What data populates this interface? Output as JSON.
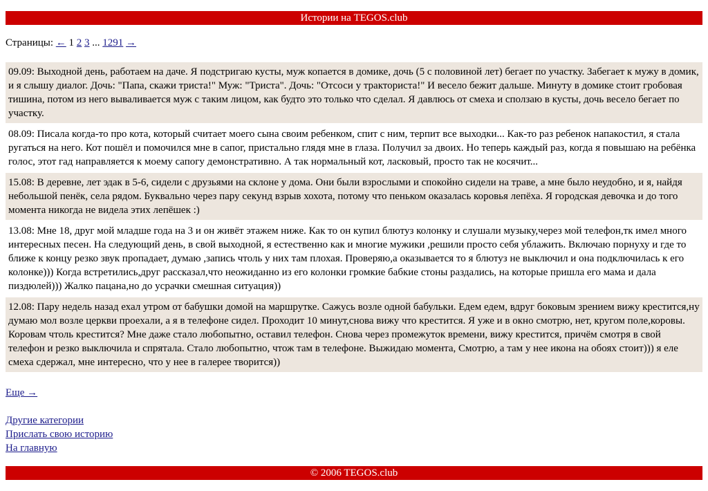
{
  "header": {
    "title": "Истории на TEGOS.club"
  },
  "pager": {
    "label": "Страницы:",
    "prev": "←",
    "current": "1",
    "pages": [
      "2",
      "3"
    ],
    "ellipsis": "...",
    "last": "1291",
    "next": "→"
  },
  "stories": [
    {
      "date": "09.09:",
      "text": "Выходной день, работаем на даче. Я подстригаю кусты, муж копается в домике, дочь (5 с половиной лет) бегает по участку. Забегает к мужу в домик, и я слышу диалог. Дочь: \"Папа, скажи триста!\" Муж: \"Триста\". Дочь: \"Отсоси у тракториста!\" И весело бежит дальше. Минуту в домике стоит гробовая тишина, потом из него вываливается муж с таким лицом, как будто это только что сделал. Я давлюсь от смеха и сползаю в кусты, дочь весело бегает по участку."
    },
    {
      "date": "08.09:",
      "text": "Писала когда-то про кота, который считает моего сына своим ребенком, спит с ним, терпит все выходки... Как-то раз ребенок напакостил, я стала ругаться на него. Кот пошёл и помочился мне в сапог, пристально глядя мне в глаза. Получил за двоих. Но теперь каждый раз, когда я повышаю на ребёнка голос, этот гад направляется к моему сапогу демонстративно. А так нормальный кот, ласковый, просто так не косячит..."
    },
    {
      "date": "15.08:",
      "text": "В деревне, лет эдак в 5-6, сидели с друзьями на склоне у дома. Они были взрослыми и спокойно сидели на траве, а мне было неудобно, и я, найдя небольшой пенёк, села рядом. Буквально через пару секунд взрыв хохота, потому что пеньком оказалась коровья лепёха. Я городская девочка и до того момента никогда не видела этих лепёшек :)"
    },
    {
      "date": "13.08:",
      "text": "Мне 18, друг мой младше года на 3 и он живёт этажем ниже. Как то он купил блютуз колонку и слушали музыку,через мой телефон,тк имел много интересных песен. На следующий день, в свой выходной, я естественно как и многие мужики ,решили просто себя ублажить. Включаю порнуху и где то ближе к концу резко звук пропадает, думаю ,запись чтоль у них там плохая. Проверяю,а оказывается то я блютуз не выключил и она подключилась к его колонке))) Когда встретились,друг рассказал,что неожиданно из его колонки громкие бабкие стоны раздались, на которые пришла его мама и дала пиздюлей))) Жалко пацана,но до усрачки смешная ситуация))"
    },
    {
      "date": "12.08:",
      "text": "Пару недель назад ехал утром от бабушки домой на маршрутке. Сажусь возле одной бабульки. Едем едем, вдруг боковым зрением вижу крестится,ну думаю мол возле церкви проехали, а я в телефоне сидел. Проходит 10 минут,снова вижу что крестится. Я уже и в окно смотрю, нет, кругом поле,коровы. Коровам чтоль крестится? Мне даже стало любопытно, оставил телефон. Снова через промежуток времени, вижу крестится, причём смотря в свой телефон и резко выключила и спрятала. Стало любопытно, чтож там в телефоне. Выжидаю момента, Смотрю, а там у нее икона на обоях стоит))) я еле смеха сдержал, мне интересно, что у нее в галерее творится))"
    }
  ],
  "more_link": "Еще →",
  "links": {
    "categories": "Другие категории",
    "submit": "Прислать свою историю",
    "home": "На главную"
  },
  "footer": {
    "text": "© 2006 TEGOS.club"
  },
  "colors": {
    "bar": "#cc0000",
    "shade": "#ede6de",
    "link": "#1a1a8a"
  }
}
